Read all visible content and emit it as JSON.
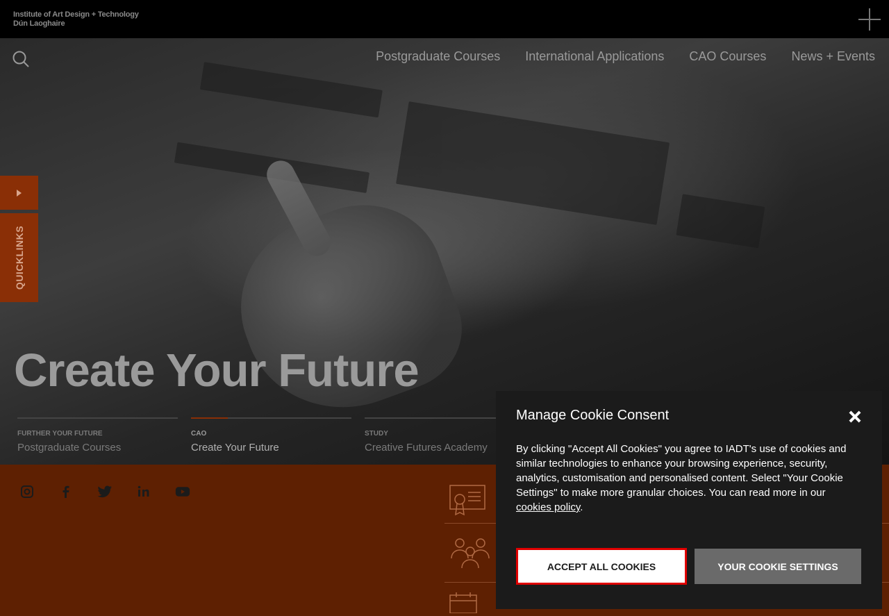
{
  "header": {
    "logo_line1": "Institute of Art Design + Technology",
    "logo_line2": "Dún Laoghaire"
  },
  "nav": {
    "links": [
      "Postgraduate Courses",
      "International Applications",
      "CAO Courses",
      "News + Events"
    ]
  },
  "quicklinks_label": "QUICKLINKS",
  "hero": {
    "title": "Create Your Future"
  },
  "slides": [
    {
      "category": "FURTHER YOUR FUTURE",
      "title": "Postgraduate Courses"
    },
    {
      "category": "CAO",
      "title": "Create Your Future"
    },
    {
      "category": "STUDY",
      "title": "Creative Futures Academy"
    }
  ],
  "socials": [
    "instagram-icon",
    "facebook-icon",
    "twitter-icon",
    "linkedin-icon",
    "youtube-icon"
  ],
  "cookie": {
    "title": "Manage Cookie Consent",
    "body_before": "By clicking \"Accept All Cookies\" you agree to IADT's use of cookies and similar technologies to enhance your browsing experience, security, analytics, customisation and personalised content. Select \"Your Cookie Settings\" to make more granular choices. You can read more in our ",
    "link": "cookies policy",
    "body_after": ".",
    "accept_label": "ACCEPT ALL COOKIES",
    "settings_label": "YOUR COOKIE SETTINGS"
  },
  "colors": {
    "accent": "#8a2f06",
    "band": "#5e2002",
    "modal_bg": "#1b1b1b",
    "focus_outline": "#e00000"
  }
}
